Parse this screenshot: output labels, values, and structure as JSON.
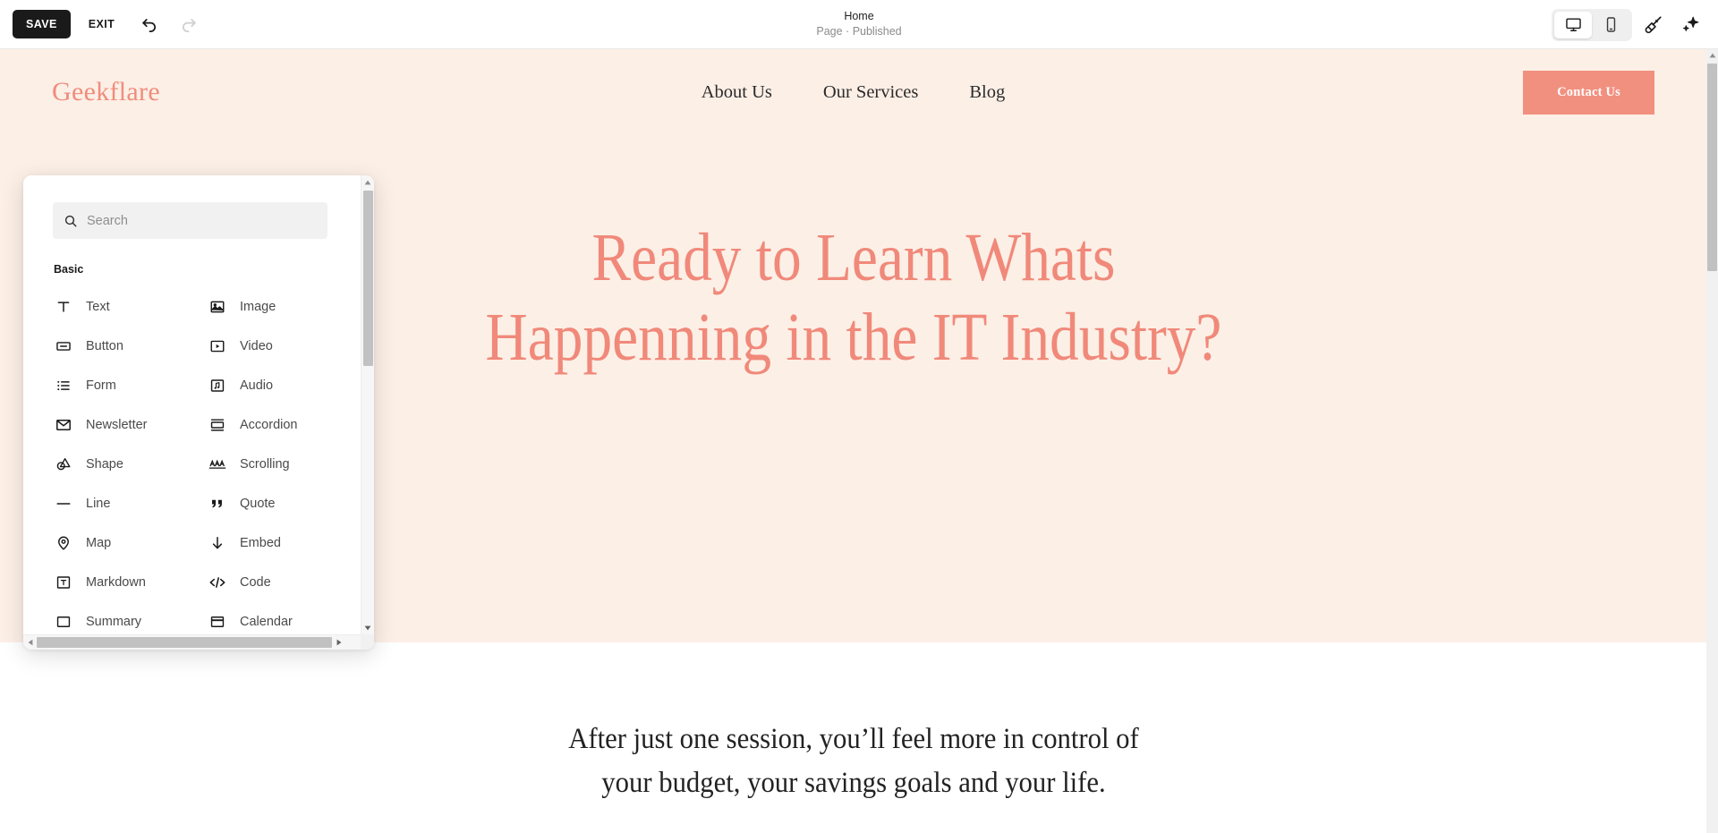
{
  "toolbar": {
    "save_label": "SAVE",
    "exit_label": "EXIT",
    "undo_icon": "undo-icon",
    "redo_icon": "redo-icon",
    "page_title": "Home",
    "page_status": "Page · Published",
    "devices": [
      {
        "name": "desktop",
        "icon": "desktop-icon",
        "active": true
      },
      {
        "name": "mobile",
        "icon": "mobile-icon",
        "active": false
      }
    ],
    "theme_icon": "paintbrush-icon",
    "ai_icon": "sparkle-icon"
  },
  "panel": {
    "search": {
      "placeholder": "Search",
      "value": "",
      "icon": "search-icon"
    },
    "groups": [
      {
        "title": "Basic",
        "items": [
          {
            "label": "Text",
            "icon": "text-icon"
          },
          {
            "label": "Image",
            "icon": "image-icon"
          },
          {
            "label": "Button",
            "icon": "button-icon"
          },
          {
            "label": "Video",
            "icon": "video-icon"
          },
          {
            "label": "Form",
            "icon": "form-icon"
          },
          {
            "label": "Audio",
            "icon": "audio-icon"
          },
          {
            "label": "Newsletter",
            "icon": "newsletter-icon"
          },
          {
            "label": "Accordion",
            "icon": "accordion-icon"
          },
          {
            "label": "Shape",
            "icon": "shape-icon"
          },
          {
            "label": "Scrolling",
            "icon": "scrolling-icon"
          },
          {
            "label": "Line",
            "icon": "line-icon"
          },
          {
            "label": "Quote",
            "icon": "quote-icon"
          },
          {
            "label": "Map",
            "icon": "map-pin-icon"
          },
          {
            "label": "Embed",
            "icon": "embed-icon"
          },
          {
            "label": "Markdown",
            "icon": "markdown-icon"
          },
          {
            "label": "Code",
            "icon": "code-icon"
          },
          {
            "label": "Summary",
            "icon": "summary-icon"
          },
          {
            "label": "Calendar",
            "icon": "calendar-icon"
          }
        ]
      }
    ]
  },
  "site": {
    "brand": "Geekflare",
    "nav": [
      {
        "label": "About Us"
      },
      {
        "label": "Our Services"
      },
      {
        "label": "Blog"
      }
    ],
    "cta_label": "Contact Us",
    "hero_heading": "Ready to Learn Whats Happenning in the IT Industry?",
    "hero_subheading": "After just one session, you’ll feel more in control of your budget, your savings goals and your life."
  },
  "colors": {
    "hero_bg": "#fcefe6",
    "accent": "#f0897a",
    "cta_bg": "#f2907f",
    "toolbar_bg": "#ffffff",
    "save_bg": "#1a1a1a"
  }
}
